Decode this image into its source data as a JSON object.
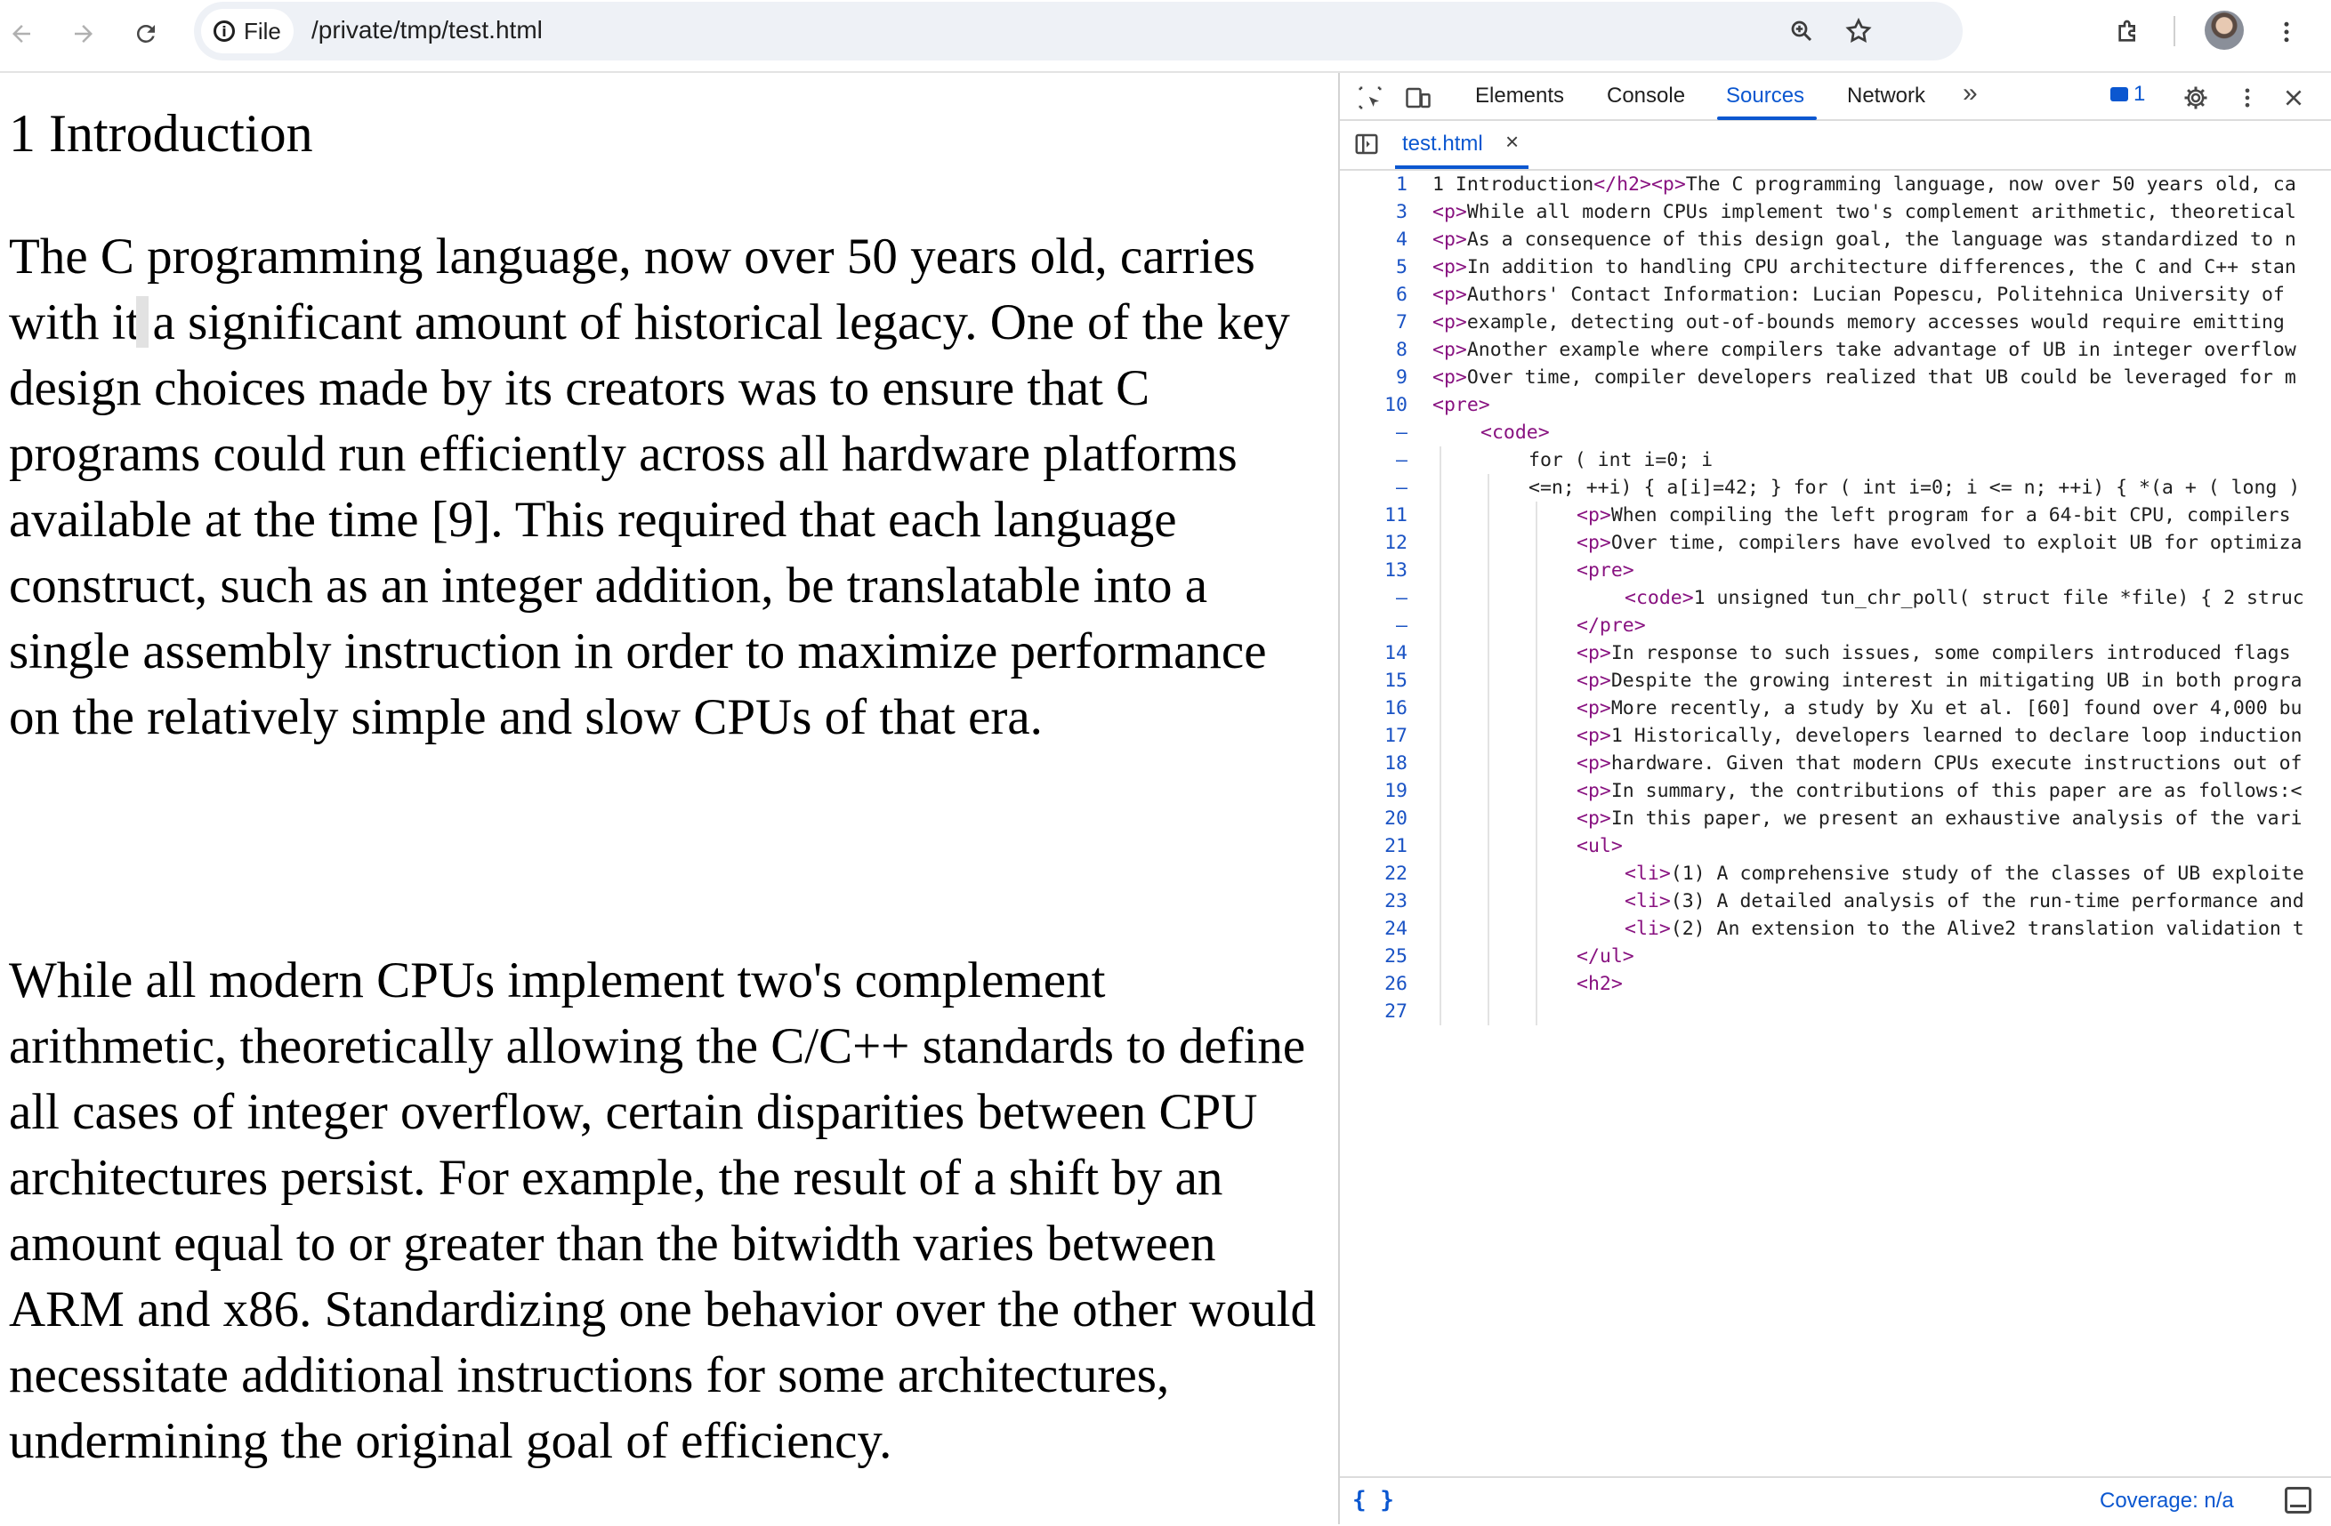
{
  "browser": {
    "site_chip_label": "File",
    "url": "/private/tmp/test.html",
    "back_icon": "arrow-left-icon",
    "forward_icon": "arrow-right-icon",
    "reload_icon": "reload-icon"
  },
  "page": {
    "heading": "1 Introduction",
    "para1_before_caret": "The C programming language, now over 50 years old, carries with it",
    "para1_after_caret": " a significant amount of historical legacy. One of the key design choices made by its creators was to ensure that C programs could run efficiently across all hardware platforms available at the time [9]. This required that each language construct, such as an integer addition, be translatable into a single assembly instruction in order to maximize performance on the relatively simple and slow CPUs of that era.",
    "para2": "While all modern CPUs implement two's complement arithmetic, theoretically allowing the C/C++ standards to define all cases of integer overflow, certain disparities between CPU architectures persist. For example, the result of a shift by an amount equal to or greater than the bitwidth varies between ARM and x86. Standardizing one behavior over the other would necessitate additional instructions for some architectures, undermining the original goal of efficiency."
  },
  "devtools": {
    "tabs": [
      "Elements",
      "Console",
      "Sources",
      "Network"
    ],
    "active_tab": "Sources",
    "more_tabs": "»",
    "issues_count": "1",
    "open_file": "test.html",
    "coverage": "Coverage: n/a",
    "pretty_print": "{ }",
    "code_lines": [
      {
        "n": "1",
        "indent": 0,
        "pre": "1 Introduction",
        "tag1": "</h2><p>",
        "post": "The C programming language, now over 50 years old, ca"
      },
      {
        "n": "3",
        "indent": 0,
        "pre": "",
        "tag1": "<p>",
        "post": "While all modern CPUs implement two's complement arithmetic, theoretical"
      },
      {
        "n": "4",
        "indent": 0,
        "pre": "",
        "tag1": "<p>",
        "post": "As a consequence of this design goal, the language was standardized to n"
      },
      {
        "n": "5",
        "indent": 0,
        "pre": "",
        "tag1": "<p>",
        "post": "In addition to handling CPU architecture differences, the C and C++ stan"
      },
      {
        "n": "6",
        "indent": 0,
        "pre": "",
        "tag1": "<p>",
        "post": "Authors' Contact Information: Lucian Popescu, Politehnica University of"
      },
      {
        "n": "7",
        "indent": 0,
        "pre": "",
        "tag1": "<p>",
        "post": "example, detecting out-of-bounds memory accesses would require emitting"
      },
      {
        "n": "8",
        "indent": 0,
        "pre": "",
        "tag1": "<p>",
        "post": "Another example where compilers take advantage of UB in integer overflow"
      },
      {
        "n": "9",
        "indent": 0,
        "pre": "",
        "tag1": "<p>",
        "post": "Over time, compiler developers realized that UB could be leveraged for m"
      },
      {
        "n": "10",
        "indent": 0,
        "pre": "",
        "tag1": "<pre>",
        "post": ""
      },
      {
        "n": "–",
        "indent": 1,
        "pre": "",
        "tag1": "<code>",
        "post": ""
      },
      {
        "n": "–",
        "indent": 2,
        "pre": "for ( int i=0; i",
        "tag1": "",
        "post": ""
      },
      {
        "n": "–",
        "indent": 2,
        "pre": "<=n; ++i) { a[i]=42; } for ( int i=0; i <= n; ++i) { *(a + ( long )",
        "tag1": "",
        "post": ""
      },
      {
        "n": "11",
        "indent": 3,
        "pre": "",
        "tag1": "<p>",
        "post": "When compiling the left program for a 64-bit CPU, compilers"
      },
      {
        "n": "12",
        "indent": 3,
        "pre": "",
        "tag1": "<p>",
        "post": "Over time, compilers have evolved to exploit UB for optimiza"
      },
      {
        "n": "13",
        "indent": 3,
        "pre": "",
        "tag1": "<pre>",
        "post": ""
      },
      {
        "n": "–",
        "indent": 4,
        "pre": "",
        "tag1": "<code>",
        "post": "1 unsigned tun_chr_poll( struct file *file) { 2 struc"
      },
      {
        "n": "–",
        "indent": 3,
        "pre": "",
        "tag1": "</pre>",
        "post": ""
      },
      {
        "n": "14",
        "indent": 3,
        "pre": "",
        "tag1": "<p>",
        "post": "In response to such issues, some compilers introduced flags"
      },
      {
        "n": "15",
        "indent": 3,
        "pre": "",
        "tag1": "<p>",
        "post": "Despite the growing interest in mitigating UB in both progra"
      },
      {
        "n": "16",
        "indent": 3,
        "pre": "",
        "tag1": "<p>",
        "post": "More recently, a study by Xu et al. [60] found over 4,000 bu"
      },
      {
        "n": "17",
        "indent": 3,
        "pre": "",
        "tag1": "<p>",
        "post": "1 Historically, developers learned to declare loop induction"
      },
      {
        "n": "18",
        "indent": 3,
        "pre": "",
        "tag1": "<p>",
        "post": "hardware. Given that modern CPUs execute instructions out of"
      },
      {
        "n": "19",
        "indent": 3,
        "pre": "",
        "tag1": "<p>",
        "post": "In summary, the contributions of this paper are as follows:<"
      },
      {
        "n": "20",
        "indent": 3,
        "pre": "",
        "tag1": "<p>",
        "post": "In this paper, we present an exhaustive analysis of the vari"
      },
      {
        "n": "21",
        "indent": 3,
        "pre": "",
        "tag1": "<ul>",
        "post": ""
      },
      {
        "n": "22",
        "indent": 4,
        "pre": "",
        "tag1": "<li>",
        "post": "(1) A comprehensive study of the classes of UB exploite"
      },
      {
        "n": "23",
        "indent": 4,
        "pre": "",
        "tag1": "<li>",
        "post": "(3) A detailed analysis of the run-time performance and"
      },
      {
        "n": "24",
        "indent": 4,
        "pre": "",
        "tag1": "<li>",
        "post": "(2) An extension to the Alive2 translation validation t"
      },
      {
        "n": "25",
        "indent": 3,
        "pre": "",
        "tag1": "</ul>",
        "post": ""
      },
      {
        "n": "26",
        "indent": 3,
        "pre": "",
        "tag1": "<h2>",
        "post": ""
      },
      {
        "n": "27",
        "indent": 3,
        "pre": "",
        "tag1": "",
        "post": ""
      }
    ]
  }
}
